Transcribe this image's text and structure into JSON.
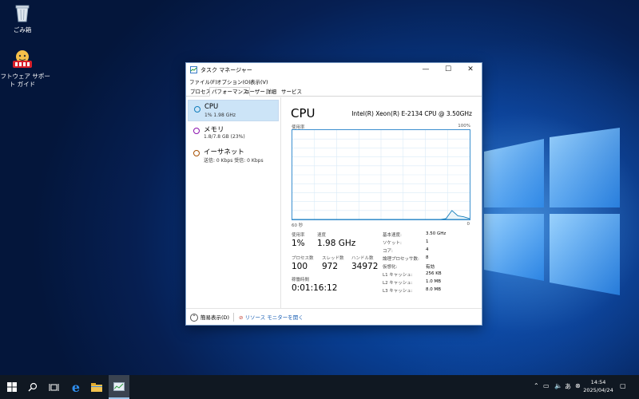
{
  "desktop": {
    "icons": [
      {
        "label": "ごみ箱",
        "icon": "recycle-bin-icon"
      },
      {
        "label": "ソフトウェア サポート ガイド",
        "icon": "support-guide-icon"
      }
    ]
  },
  "window": {
    "title": "タスク マネージャー",
    "menu": [
      "ファイル(F)",
      "オプション(O)",
      "表示(V)"
    ],
    "tabs": [
      "プロセス",
      "パフォーマンス",
      "ユーザー",
      "詳細",
      "サービス"
    ],
    "active_tab": "パフォーマンス",
    "resources": [
      {
        "name": "CPU",
        "detail": "1%  1.98 GHz",
        "color": "#117dbb",
        "selected": true
      },
      {
        "name": "メモリ",
        "detail": "1.8/7.8 GB (23%)",
        "color": "#8b12ae",
        "selected": false
      },
      {
        "name": "イーサネット",
        "detail": "送信: 0 Kbps  受信: 0 Kbps",
        "color": "#a74f01",
        "selected": false
      }
    ],
    "cpu": {
      "heading": "CPU",
      "model": "Intel(R) Xeon(R) E-2134 CPU @ 3.50GHz",
      "graph_label_left": "使用率",
      "graph_label_right": "100%",
      "axis_left": "60 秒",
      "axis_right": "0",
      "usage_label": "使用率",
      "usage_value": "1%",
      "speed_label": "速度",
      "speed_value": "1.98 GHz",
      "processes_label": "プロセス数",
      "processes_value": "100",
      "threads_label": "スレッド数",
      "threads_value": "972",
      "handles_label": "ハンドル数",
      "handles_value": "34972",
      "uptime_label": "稼働時間",
      "uptime_value": "0:01:16:12",
      "specs": [
        {
          "key": "基本速度:",
          "value": "3.50 GHz"
        },
        {
          "key": "ソケット:",
          "value": "1"
        },
        {
          "key": "コア:",
          "value": "4"
        },
        {
          "key": "論理プロセッサ数:",
          "value": "8"
        },
        {
          "key": "仮想化:",
          "value": "有効"
        },
        {
          "key": "L1 キャッシュ:",
          "value": "256 KB"
        },
        {
          "key": "L2 キャッシュ:",
          "value": "1.0 MB"
        },
        {
          "key": "L3 キャッシュ:",
          "value": "8.0 MB"
        }
      ]
    },
    "footer": {
      "fewer_details": "簡易表示(D)",
      "resource_monitor": "リソース モニターを開く"
    }
  },
  "taskbar": {
    "time": "14:54",
    "date": "2025/04/24",
    "apps": [
      "start-icon",
      "search-icon",
      "task-view-icon",
      "edge-icon",
      "file-explorer-icon",
      "task-manager-icon"
    ]
  },
  "chart_data": {
    "type": "line",
    "title": "",
    "xlabel": "",
    "ylabel": "",
    "x": [
      0,
      2,
      4,
      6,
      8,
      10,
      12,
      14,
      16,
      18,
      20,
      22,
      24,
      26,
      28,
      30,
      32,
      34,
      36,
      38,
      40,
      42,
      44,
      46,
      48,
      50,
      52,
      54,
      56,
      58,
      60
    ],
    "series": [
      {
        "values": [
          0,
          0,
          0,
          0,
          0,
          0,
          0,
          0,
          0,
          0,
          0,
          0,
          0,
          0,
          0,
          0,
          0,
          0,
          0,
          0,
          0,
          0,
          0,
          0,
          0,
          0,
          0,
          0,
          0,
          0,
          0
        ]
      },
      {
        "values": [
          0,
          0,
          0,
          0,
          0,
          0,
          0,
          0,
          0,
          0,
          0,
          0,
          0,
          0,
          0,
          0,
          0,
          0,
          0,
          0,
          0,
          0,
          0,
          0,
          0,
          0,
          0,
          0,
          0,
          0,
          0
        ]
      },
      {
        "values": [
          0,
          0,
          0,
          0,
          0,
          0,
          0,
          0,
          0,
          0,
          0,
          0,
          0,
          0,
          0,
          0,
          0,
          0,
          0,
          0,
          0,
          0,
          0,
          0,
          0,
          0,
          0,
          0,
          0,
          0,
          0
        ]
      },
      {
        "values": [
          0,
          0,
          0,
          0,
          0,
          0,
          0,
          0,
          0,
          0,
          0,
          0,
          0,
          0,
          0,
          0,
          0,
          0,
          0,
          0,
          0,
          0,
          0,
          0,
          0,
          0,
          0,
          0,
          0,
          0,
          0
        ]
      },
      {
        "values": [
          0,
          0,
          0,
          0,
          0,
          0,
          0,
          0,
          0,
          0,
          0,
          0,
          0,
          0,
          0,
          0,
          0,
          0,
          0,
          0,
          0,
          0,
          0,
          0,
          0,
          0,
          0,
          0,
          0,
          0,
          0
        ]
      },
      {
        "values": [
          0,
          0,
          0,
          0,
          0,
          0,
          0,
          0,
          0,
          0,
          0,
          0,
          0,
          0,
          0,
          0,
          0,
          0,
          0,
          0,
          0,
          0,
          0,
          0,
          0,
          0,
          0,
          0,
          0,
          0,
          0
        ]
      },
      {
        "values": [
          0,
          0,
          0,
          0,
          0,
          0,
          0,
          0,
          0,
          0,
          0,
          0,
          0,
          0,
          0,
          0,
          0,
          0,
          0,
          0,
          0,
          0,
          0,
          0,
          0,
          0,
          0,
          0,
          0,
          0,
          0
        ]
      },
      {
        "values": [
          0,
          0,
          0,
          0,
          0,
          0,
          0,
          0,
          0,
          0,
          0,
          0,
          0,
          0,
          0,
          0,
          0,
          0,
          0,
          0,
          0,
          0,
          0,
          0,
          0,
          0,
          1,
          10,
          4,
          3,
          1
        ]
      }
    ],
    "ylim": [
      0,
      100
    ],
    "xlim": [
      0,
      60
    ],
    "grid": true
  }
}
